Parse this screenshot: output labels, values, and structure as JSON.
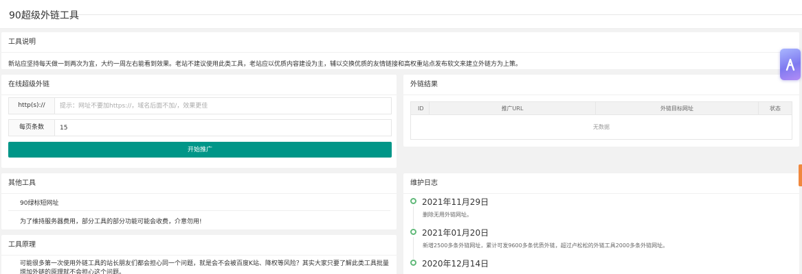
{
  "header": {
    "title": "90超级外链工具"
  },
  "description": {
    "title": "工具说明",
    "text": "新站应坚持每天做一到两次为宜，大约一周左右能看到效果。老站不建议使用此类工具，老站应以优质内容建设为主，辅以交换优质的友情链接和高权重站点发布软文来建立外链方为上策。"
  },
  "online": {
    "title": "在线超级外链",
    "url_label": "http(s)://",
    "url_value": "",
    "url_placeholder": "提示：网址不要加https://，域名后面不加/，效果更佳",
    "count_label": "每页条数",
    "count_value": "15",
    "start_button": "开始推广"
  },
  "result": {
    "title": "外链结果",
    "columns": [
      "ID",
      "推广URL",
      "外链目标网址",
      "状态"
    ],
    "empty_text": "无数据"
  },
  "other": {
    "title": "其他工具",
    "link": "90绿标短网址",
    "note": "为了维持服务器费用，部分工具的部分功能可能会收费，介意勿用!"
  },
  "principle": {
    "title": "工具原理",
    "text": "可能很多第一次使用外链工具的站长朋友们都会担心同一个问题，就是会不会被百度K站、降权等风险？其实大家只要了解此类工具批量增加外链的原理就不会担心这个问题。"
  },
  "log": {
    "title": "维护日志",
    "items": [
      {
        "date": "2021年11月29日",
        "text": "删除无用外链网址。"
      },
      {
        "date": "2021年01月20日",
        "text": "新增2500多条外链网址，累计可发9600多条优质外链，超过卢松松的外链工具2000多条外链网址。"
      },
      {
        "date": "2020年12月14日",
        "text": ""
      }
    ]
  },
  "colors": {
    "accent": "#009688",
    "timeline": "#5fb878",
    "side_tab": "#f0883e"
  },
  "icons": {
    "float_widget": "cursor-arrow-icon"
  }
}
